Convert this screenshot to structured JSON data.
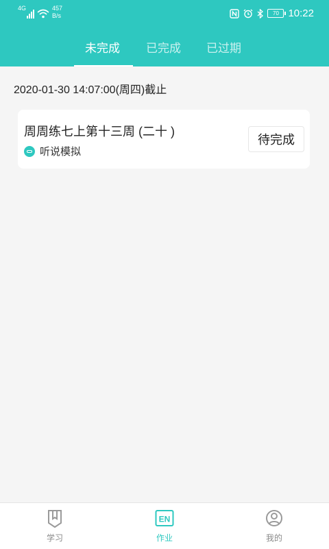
{
  "status_bar": {
    "network": "4G",
    "speed_value": "457",
    "speed_unit": "B/s",
    "battery": "70",
    "time": "10:22"
  },
  "tabs": [
    {
      "label": "未完成",
      "active": true
    },
    {
      "label": "已完成",
      "active": false
    },
    {
      "label": "已过期",
      "active": false
    }
  ],
  "deadline": "2020-01-30 14:07:00(周四)截止",
  "assignment": {
    "title": "周周练七上第十三周 (二十 )",
    "type": "听说模拟",
    "status": "待完成"
  },
  "bottom_nav": [
    {
      "label": "学习",
      "icon": "book-icon"
    },
    {
      "label": "作业",
      "icon": "en-icon",
      "active": true
    },
    {
      "label": "我的",
      "icon": "profile-icon"
    }
  ],
  "colors": {
    "accent": "#2ec8c0",
    "background": "#f5f5f5",
    "card": "#ffffff"
  }
}
